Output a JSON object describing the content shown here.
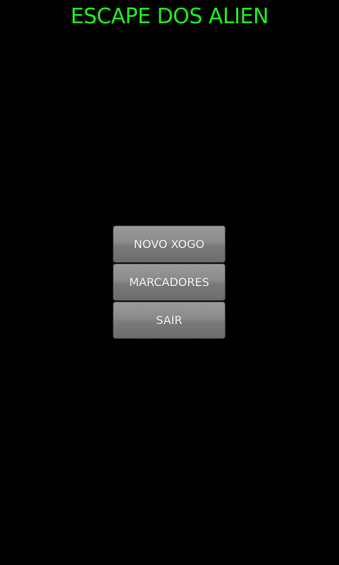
{
  "title": "ESCAPE DOS ALIEN",
  "menu": {
    "new_game": "NOVO XOGO",
    "scores": "MARCADORES",
    "exit": "SAIR"
  },
  "colors": {
    "background": "#000000",
    "title": "#22ee22",
    "button_text": "#ffffff",
    "button_face": "#8a8a8a"
  }
}
